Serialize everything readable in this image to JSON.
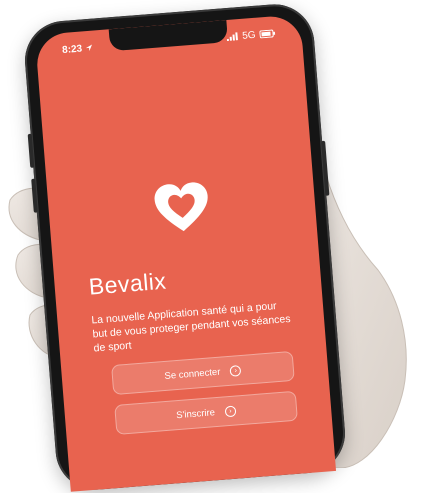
{
  "status_bar": {
    "time": "8:23",
    "network": "5G",
    "icons": [
      "location-arrow-icon",
      "signal-icon",
      "battery-icon"
    ]
  },
  "app": {
    "logo_icon": "heart-icon",
    "title": "Bevalix",
    "description": "La nouvelle Application santé qui a pour but de vous proteger pendant vos séances de sport"
  },
  "buttons": {
    "login_label": "Se connecter",
    "signup_label": "S'inscrire",
    "arrow_icon": "arrow-right-circle-icon"
  },
  "colors": {
    "screen_background": "#e8634f",
    "text": "#ffffff",
    "phone_frame": "#151515"
  }
}
